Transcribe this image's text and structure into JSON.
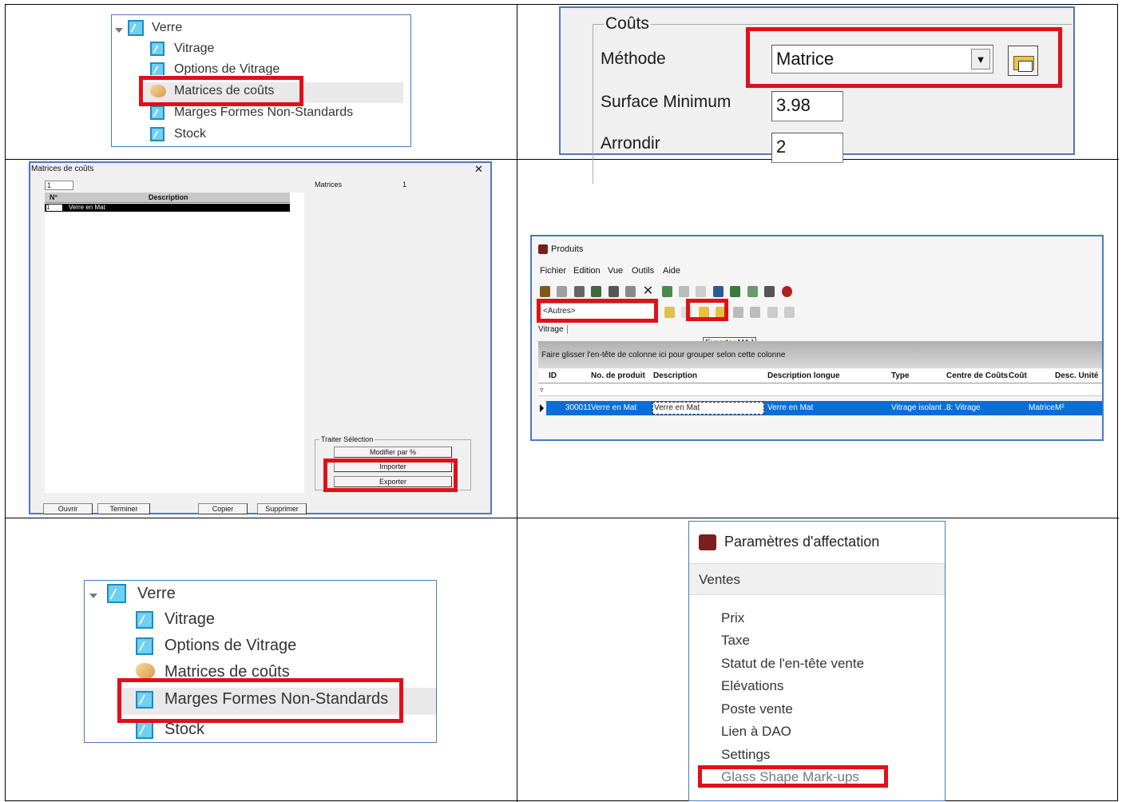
{
  "tree_top": {
    "items": [
      {
        "label": "Verre",
        "icon": "glass-folder-icon"
      },
      {
        "label": "Vitrage",
        "icon": "glass-icon"
      },
      {
        "label": "Options de Vitrage",
        "icon": "glass-icon"
      },
      {
        "label": "Matrices de coûts",
        "icon": "coins-icon"
      },
      {
        "label": "Marges Formes Non-Standards",
        "icon": "glass-icon"
      },
      {
        "label": "Stock",
        "icon": "glass-icon"
      }
    ],
    "highlighted": "Matrices de coûts"
  },
  "cost_panel": {
    "group_title": "Coûts",
    "method_label": "Méthode",
    "method_value": "Matrice",
    "min_surface_label": "Surface Minimum",
    "min_surface_value": "3.98",
    "round_label": "Arrondir",
    "round_value": "2"
  },
  "matrices_dialog": {
    "title": "Matrices de coûts",
    "close_glyph": "✕",
    "search_value": "1",
    "matrices_label": "Matrices",
    "matrices_count": "1",
    "table_headers": [
      "N°",
      "Description"
    ],
    "rows": [
      {
        "no": "1",
        "description": "Verre en Mat"
      }
    ],
    "group_title": "Traiter Sélection",
    "btn_modify": "Modifier par %",
    "btn_import": "Importer",
    "btn_export": "Exporter",
    "btn_open": "Ouvrir",
    "btn_finish": "Terminer",
    "btn_copy": "Copier",
    "btn_delete": "Supprimer"
  },
  "produits": {
    "title": "Produits",
    "menu": [
      "Fichier",
      "Edition",
      "Vue",
      "Outils",
      "Aide"
    ],
    "filter_value": "<Autres>",
    "tab": "Vitrage",
    "tooltip": "Exporter MAJ",
    "group_hint": "Faire glisser l'en-tête de colonne ici pour grouper selon cette colonne",
    "columns": [
      "ID",
      "No. de produit",
      "Description",
      "Description longue",
      "Type",
      "Centre de Coûts",
      "Coût",
      "Desc. Unité"
    ],
    "row": {
      "id": "",
      "no": "300011",
      "description": "Verre en Mat",
      "description_edit": "Verre en Mat",
      "description_longue": "Verre en Mat",
      "type": "Vitrage isolant ...",
      "centre": "8: Vitrage",
      "cout": "Matrice",
      "unite": "M²"
    }
  },
  "tree_bottom": {
    "items": [
      {
        "label": "Verre",
        "icon": "glass-folder-icon"
      },
      {
        "label": "Vitrage",
        "icon": "glass-icon"
      },
      {
        "label": "Options de Vitrage",
        "icon": "glass-icon"
      },
      {
        "label": "Matrices de coûts",
        "icon": "coins-icon"
      },
      {
        "label": "Marges Formes Non-Standards",
        "icon": "glass-icon"
      },
      {
        "label": "Stock",
        "icon": "glass-icon"
      }
    ],
    "highlighted": "Marges Formes Non-Standards"
  },
  "parametres": {
    "title": "Paramètres d'affectation",
    "section": "Ventes",
    "items": [
      "Prix",
      "Taxe",
      "Statut de l'en-tête vente",
      "Elévations",
      "Poste vente",
      "Lien à DAO",
      "Settings",
      "Glass Shape Mark-ups"
    ],
    "highlighted": "Glass Shape Mark-ups"
  },
  "colors": {
    "highlight_red": "#e0101a",
    "window_border": "#4a78c2",
    "selection_blue": "#0a6ed6"
  }
}
